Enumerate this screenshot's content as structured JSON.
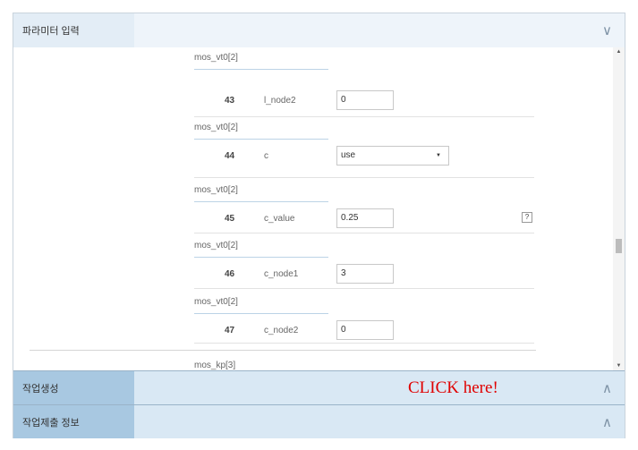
{
  "sections": {
    "param": {
      "title": "파라미터 입력",
      "icon": "chevron-down-icon",
      "chevron": "∨"
    },
    "job": {
      "title": "작업생성",
      "icon": "chevron-up-icon",
      "chevron": "∧",
      "overlay": "CLICK here!"
    },
    "submit": {
      "title": "작업제출 정보",
      "icon": "chevron-up-icon",
      "chevron": "∧"
    }
  },
  "rows": [
    {
      "group": "mos_vt0[2]",
      "num": "43",
      "name": "l_node2",
      "value": "0",
      "type": "input"
    },
    {
      "group": "mos_vt0[2]",
      "num": "44",
      "name": "c",
      "value": "use",
      "type": "select"
    },
    {
      "group": "mos_vt0[2]",
      "num": "45",
      "name": "c_value",
      "value": "0.25",
      "type": "input",
      "help": "?"
    },
    {
      "group": "mos_vt0[2]",
      "num": "46",
      "name": "c_node1",
      "value": "3",
      "type": "input"
    },
    {
      "group": "mos_vt0[2]",
      "num": "47",
      "name": "c_node2",
      "value": "0",
      "type": "input"
    }
  ],
  "next_group": "mos_kp[3]",
  "scroll": {
    "up": "▲",
    "down": "▼"
  },
  "colors": {
    "accent": "#a8c8e1",
    "click_text": "#e00000"
  }
}
